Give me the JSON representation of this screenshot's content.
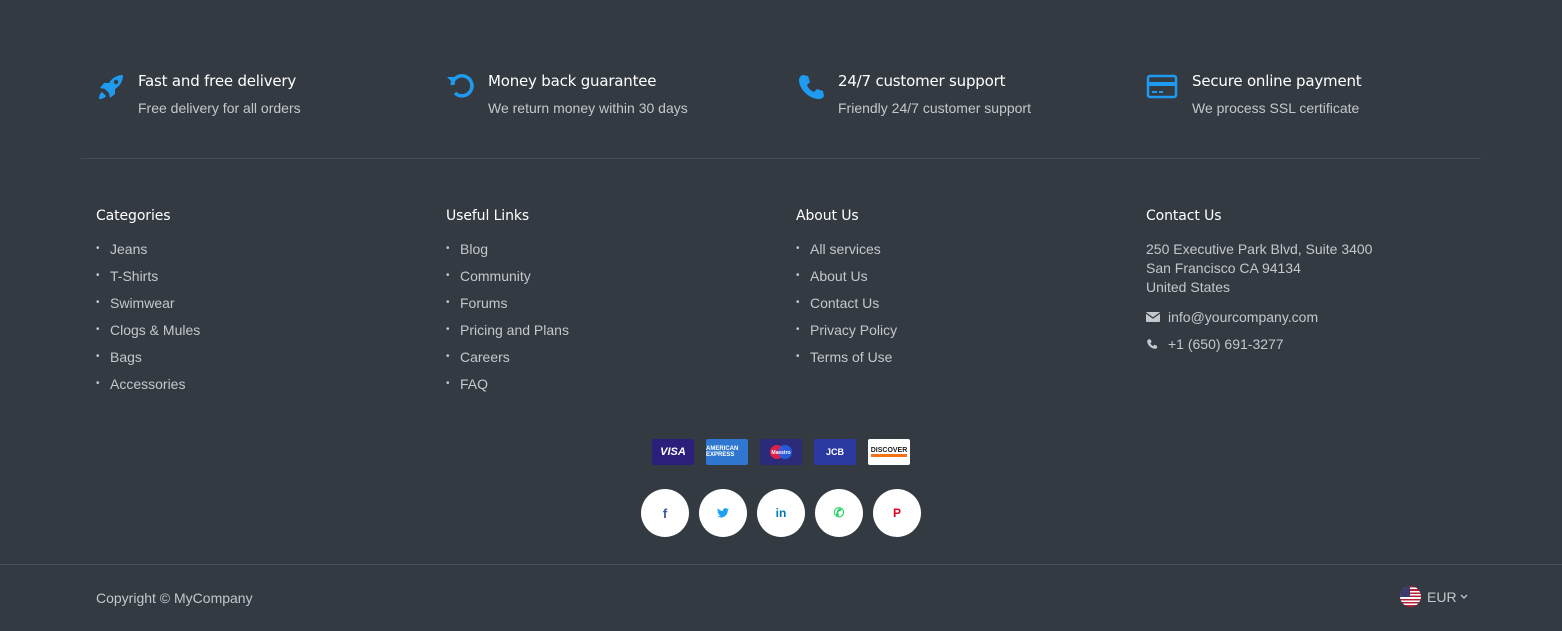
{
  "features": [
    {
      "icon": "rocket-icon",
      "title": "Fast and free delivery",
      "desc": "Free delivery for all orders"
    },
    {
      "icon": "refresh-icon",
      "title": "Money back guarantee",
      "desc": "We return money within 30 days"
    },
    {
      "icon": "phone-icon",
      "title": "24/7 customer support",
      "desc": "Friendly 24/7 customer support"
    },
    {
      "icon": "credit-card-icon",
      "title": "Secure online payment",
      "desc": "We process SSL certificate"
    }
  ],
  "categories": {
    "title": "Categories",
    "items": [
      "Jeans",
      "T-Shirts",
      "Swimwear",
      "Clogs & Mules",
      "Bags",
      "Accessories"
    ]
  },
  "useful_links": {
    "title": "Useful Links",
    "items": [
      "Blog",
      "Community",
      "Forums",
      "Pricing and Plans",
      "Careers",
      "FAQ"
    ]
  },
  "about_us": {
    "title": "About Us",
    "items": [
      "All services",
      "About Us",
      "Contact Us",
      "Privacy Policy",
      "Terms of Use"
    ]
  },
  "contact": {
    "title": "Contact Us",
    "address1": "250 Executive Park Blvd, Suite 3400",
    "address2": "San Francisco CA 94134",
    "address3": "United States",
    "email": "info@yourcompany.com",
    "phone": "+1 (650) 691-3277"
  },
  "payments": [
    {
      "name": "visa",
      "label": "VISA"
    },
    {
      "name": "amex",
      "label": "AMERICAN EXPRESS"
    },
    {
      "name": "maestro",
      "label": "Maestro"
    },
    {
      "name": "jcb",
      "label": "JCB"
    },
    {
      "name": "discover",
      "label": "DISCOVER"
    }
  ],
  "social": [
    {
      "name": "facebook",
      "glyph": "f",
      "color": "#3b5998"
    },
    {
      "name": "twitter",
      "glyph": "t",
      "color": "#1da1f2"
    },
    {
      "name": "linkedin",
      "glyph": "in",
      "color": "#0077b5"
    },
    {
      "name": "whatsapp",
      "glyph": "✆",
      "color": "#25d366"
    },
    {
      "name": "pinterest",
      "glyph": "P",
      "color": "#e60023"
    }
  ],
  "footer": {
    "copyright": "Copyright © MyCompany",
    "currency": "EUR"
  },
  "colors": {
    "background": "#343a42",
    "accent": "#1e9bf0"
  }
}
